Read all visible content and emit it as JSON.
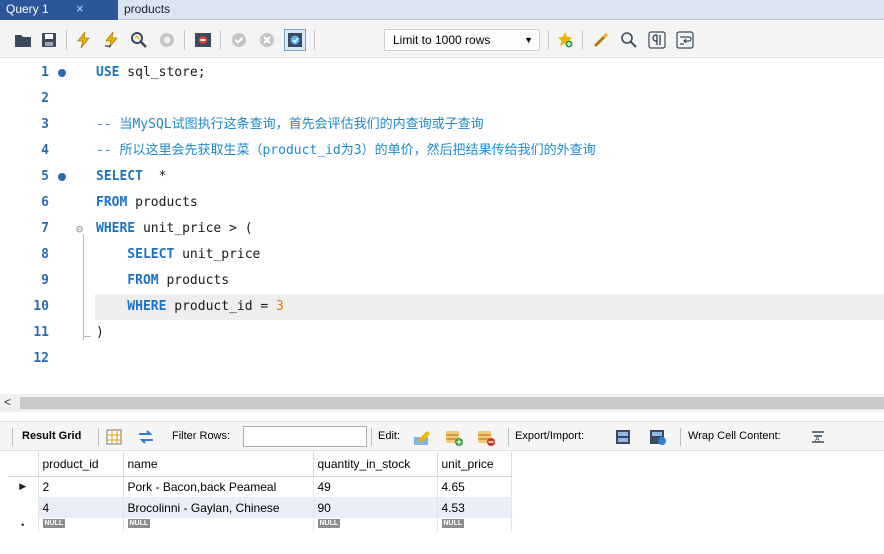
{
  "tabs": [
    {
      "label": "Query 1",
      "active": true
    },
    {
      "label": "products",
      "active": false
    }
  ],
  "tab_close_glyph": "×",
  "toolbar": {
    "limit_label": "Limit to 1000 rows",
    "icons": [
      "open-folder-icon",
      "save-icon",
      "execute-icon",
      "execute-current-icon",
      "explain-icon",
      "stop-icon",
      "toggle-output-icon",
      "commit-icon",
      "rollback-icon",
      "autocommit-icon",
      "bookmark-star-icon",
      "beautify-icon",
      "find-icon",
      "invisible-chars-icon",
      "wrap-icon"
    ]
  },
  "editor": {
    "lines": [
      {
        "n": "1",
        "dot": true,
        "tokens": [
          {
            "t": "USE",
            "c": "kw"
          },
          {
            "t": " sql_store;",
            "c": ""
          }
        ]
      },
      {
        "n": "2",
        "dot": false,
        "tokens": []
      },
      {
        "n": "3",
        "dot": false,
        "tokens": [
          {
            "t": "-- 当MySQL试图执行这条查询，首先会评估我们的内查询或子查询",
            "c": "cm"
          }
        ]
      },
      {
        "n": "4",
        "dot": false,
        "tokens": [
          {
            "t": "-- 所以这里会先获取生菜（product_id为3）的单价，然后把结果传给我们的外查询",
            "c": "cm"
          }
        ]
      },
      {
        "n": "5",
        "dot": true,
        "tokens": [
          {
            "t": "SELECT",
            "c": "kw"
          },
          {
            "t": "  *",
            "c": ""
          }
        ]
      },
      {
        "n": "6",
        "dot": false,
        "tokens": [
          {
            "t": "FROM",
            "c": "kw"
          },
          {
            "t": " products",
            "c": ""
          }
        ]
      },
      {
        "n": "7",
        "dot": false,
        "tokens": [
          {
            "t": "WHERE",
            "c": "kw"
          },
          {
            "t": " unit_price > (",
            "c": ""
          }
        ]
      },
      {
        "n": "8",
        "dot": false,
        "tokens": [
          {
            "t": "    SELECT",
            "c": "kw"
          },
          {
            "t": " unit_price",
            "c": ""
          }
        ]
      },
      {
        "n": "9",
        "dot": false,
        "tokens": [
          {
            "t": "    FROM",
            "c": "kw"
          },
          {
            "t": " products",
            "c": ""
          }
        ]
      },
      {
        "n": "10",
        "dot": false,
        "tokens": [
          {
            "t": "    WHERE",
            "c": "kw"
          },
          {
            "t": " product_id = ",
            "c": ""
          },
          {
            "t": "3",
            "c": "num"
          }
        ]
      },
      {
        "n": "11",
        "dot": false,
        "tokens": [
          {
            "t": ")",
            "c": ""
          }
        ]
      },
      {
        "n": "12",
        "dot": false,
        "tokens": []
      }
    ]
  },
  "scroll_left_glyph": "<",
  "result_toolbar": {
    "result_grid": "Result Grid",
    "filter_rows": "Filter Rows:",
    "filter_value": "",
    "edit": "Edit:",
    "export_import": "Export/Import:",
    "wrap_cell": "Wrap Cell Content:"
  },
  "grid": {
    "columns": [
      "product_id",
      "name",
      "quantity_in_stock",
      "unit_price"
    ],
    "rows": [
      [
        "2",
        "Pork - Bacon,back Peameal",
        "49",
        "4.65"
      ],
      [
        "4",
        "Brocolinni - Gaylan, Chinese",
        "90",
        "4.53"
      ]
    ],
    "null_label": "NULL",
    "current_marker": "▶",
    "new_marker": "•"
  },
  "colors": {
    "accent": "#2b579a",
    "keyword": "#1a73c9",
    "comment": "#1e88c9",
    "number": "#e07b00",
    "line_number": "#2b6cb0"
  }
}
